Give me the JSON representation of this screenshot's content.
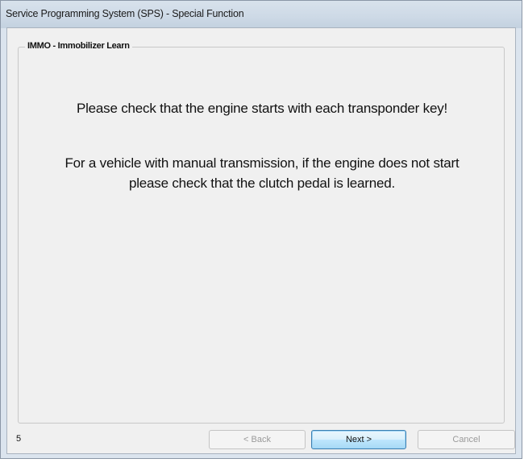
{
  "window": {
    "title": "Service Programming System (SPS) - Special Function"
  },
  "group": {
    "legend": "IMMO - Immobilizer Learn"
  },
  "messages": {
    "line1": "Please check that the engine starts with each transponder key!",
    "line2a": "For a vehicle with manual transmission, if the engine does not start",
    "line2b": "please check that the clutch pedal is learned."
  },
  "footer": {
    "step_number": "5",
    "back_label": "< Back",
    "next_label": "Next >",
    "cancel_label": "Cancel"
  },
  "colors": {
    "client_background": "#f0f0f0",
    "title_bar": "#cdd9e6",
    "next_button_accent": "#3c7fb1"
  }
}
